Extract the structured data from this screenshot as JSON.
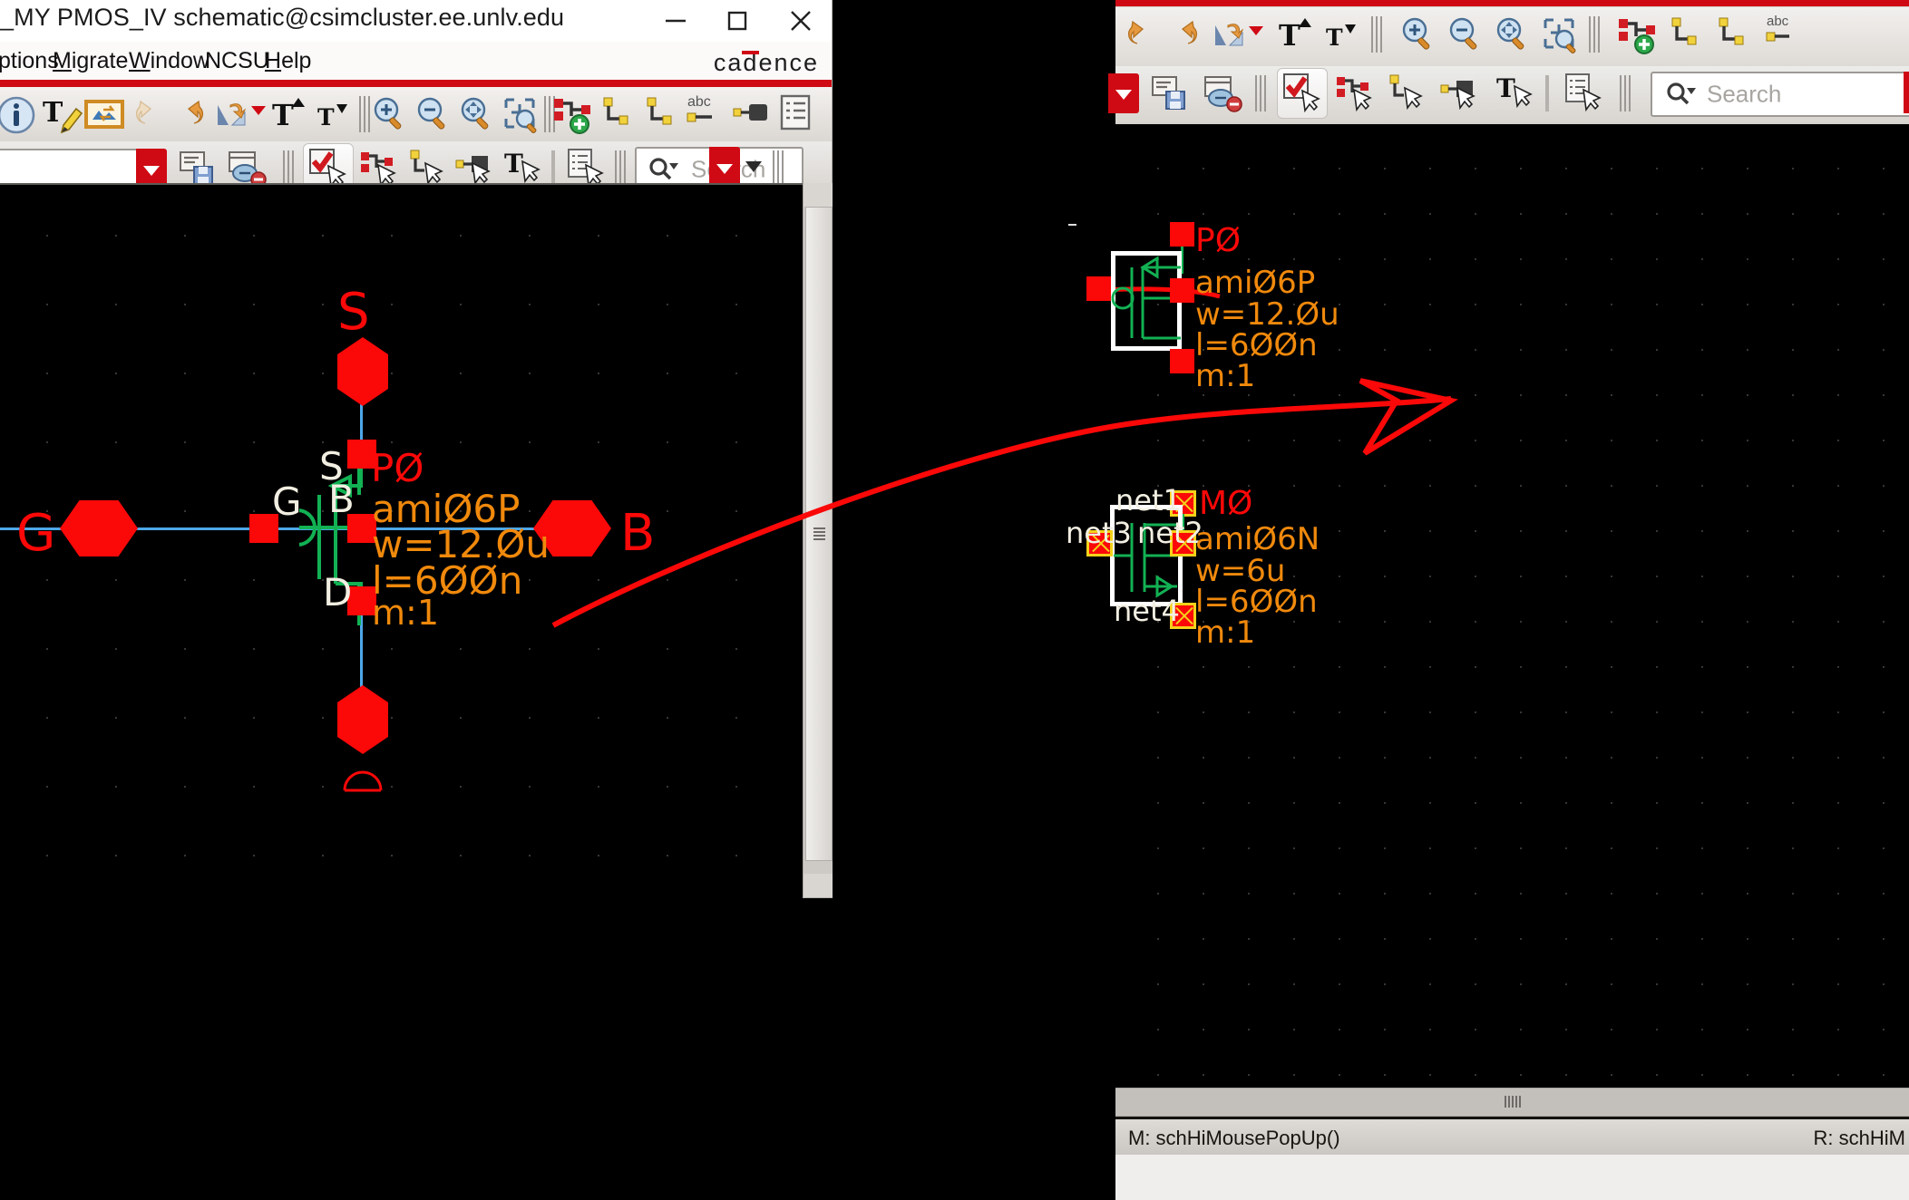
{
  "front_window": {
    "title": "_MY PMOS_IV schematic@csimcluster.ee.unlv.edu",
    "window_buttons": [
      {
        "name": "minimize",
        "glyph": "minimize-icon"
      },
      {
        "name": "maximize",
        "glyph": "maximize-icon"
      },
      {
        "name": "close",
        "glyph": "close-icon"
      }
    ],
    "menu": [
      {
        "label": "ptions",
        "accel": ""
      },
      {
        "label": "Migrate",
        "accel": "M"
      },
      {
        "label": "Window",
        "accel": "W"
      },
      {
        "label": "NCSU",
        "accel": ""
      },
      {
        "label": "Help",
        "accel": "H"
      }
    ],
    "brand": "cadence",
    "toolbar_row1": [
      "info-icon",
      "text-edit-icon",
      "palette-icon",
      "undo-icon",
      "redo-icon",
      "mirror-rotate-icon",
      "rotate-dropdown-icon",
      "text-up-icon",
      "text-down-icon",
      "zoom-in-icon",
      "zoom-out-icon",
      "zoom-fit-icon",
      "zoom-area-icon",
      "hierarchy-add-icon",
      "wire-icon",
      "wire-name-icon",
      "abc-label-icon",
      "pin-icon",
      "properties-icon"
    ],
    "toolbar_row2": [
      "combo-field",
      "combo-dropdown-icon",
      "save-copy-icon",
      "discard-icon",
      "check-select-icon",
      "hierarchy-select-icon",
      "wire-select-icon",
      "pin-select-icon",
      "text-select-icon",
      "list-select-icon"
    ],
    "search": {
      "placeholder": "Search",
      "value": ""
    }
  },
  "back_window": {
    "toolbar_row1": [
      "undo-icon",
      "redo-icon",
      "mirror-rotate-icon",
      "rotate-dropdown-icon",
      "text-up-icon",
      "text-down-icon",
      "zoom-in-icon",
      "zoom-out-icon",
      "zoom-fit-icon",
      "zoom-area-icon",
      "hierarchy-add-icon",
      "wire-icon",
      "wire-name-icon",
      "abc-label-icon"
    ],
    "toolbar_row2": [
      "combo-dropdown-icon",
      "save-copy-icon",
      "discard-icon",
      "check-select-icon",
      "hierarchy-select-icon",
      "wire-select-icon",
      "pin-select-icon",
      "text-select-icon",
      "list-select-icon"
    ],
    "search": {
      "placeholder": "Search",
      "value": ""
    },
    "abc_label": "abc",
    "status": {
      "mouse_middle": "M: schHiMousePopUp()",
      "mouse_right": "R: schHiM"
    }
  },
  "front_schematic": {
    "terminal_labels": {
      "top": "S",
      "left": "G",
      "right": "B"
    },
    "device": {
      "instance_name": "PØ",
      "model": "amiØ6P",
      "width": "w=12.Øu",
      "length": "l=6ØØn",
      "multiplier": "m:1"
    },
    "pin_names": {
      "source": "S",
      "gate": "G",
      "bulk": "B",
      "drain": "D"
    },
    "colors": {
      "background": "#000000",
      "pin_red": "#fb0808",
      "symbol_green": "#12b153",
      "wire_blue": "#4ea7e8",
      "param_orange": "#f0890c",
      "pin_label_white": "#f2efe2",
      "instance_red": "#fb0808"
    }
  },
  "back_schematic": {
    "pmos": {
      "instance_name": "PØ",
      "model": "amiØ6P",
      "width": "w=12.Øu",
      "length": "l=6ØØn",
      "multiplier": "m:1"
    },
    "nmos": {
      "instance_name": "MØ",
      "model": "amiØ6N",
      "width": "w=6u",
      "length": "l=6ØØn",
      "multiplier": "m:1",
      "nets": [
        "net1",
        "net3",
        "net2",
        "net4"
      ]
    }
  }
}
